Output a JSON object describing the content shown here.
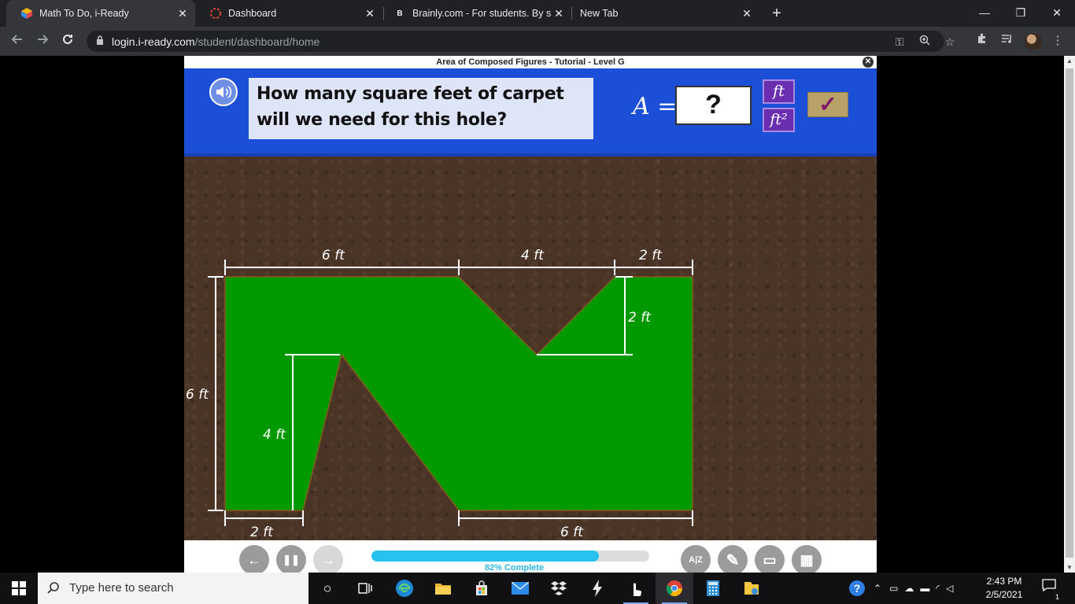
{
  "browser": {
    "tabs": [
      {
        "title": "Math To Do, i-Ready",
        "active": true
      },
      {
        "title": "Dashboard",
        "active": false
      },
      {
        "title": "Brainly.com - For students. By stu",
        "active": false
      },
      {
        "title": "New Tab",
        "active": false
      }
    ],
    "tab_close_glyph": "✕",
    "new_tab_glyph": "+",
    "window_controls": {
      "minimize": "—",
      "maximize": "❐",
      "close": "✕"
    },
    "address": {
      "host": "login.i-ready.com",
      "path": "/student/dashboard/home"
    }
  },
  "lesson": {
    "title": "Area of Composed Figures - Tutorial - Level G",
    "close_glyph": "✕",
    "question": "How many square feet of carpet will we need for this hole?",
    "equation_label": "A =",
    "answer_placeholder": "?",
    "unit_options": [
      "ft",
      "ft²"
    ],
    "check_glyph": "✓",
    "figure": {
      "fill_color": "#009a00",
      "labels": {
        "top_left": "6 ft",
        "top_mid": "4 ft",
        "top_right": "2 ft",
        "notch_depth": "2 ft",
        "left_height": "6 ft",
        "inner_height": "4 ft",
        "bottom_left": "2 ft",
        "bottom_right": "6 ft"
      }
    },
    "progress": {
      "percent": 82,
      "label": "82% Complete"
    },
    "controls": {
      "back": "←",
      "pause": "❚❚",
      "forward": "→"
    },
    "tools": [
      "A|Z",
      "✎",
      "▭",
      "▦"
    ]
  },
  "taskbar": {
    "search_placeholder": "Type here to search",
    "apps": [
      "cortana",
      "task-view",
      "edge",
      "file-explorer",
      "store",
      "mail",
      "dropbox",
      "app-bolt",
      "app-touch",
      "chrome",
      "calculator",
      "files"
    ],
    "clock_time": "2:43 PM",
    "clock_date": "2/5/2021",
    "notification_count": "1"
  }
}
